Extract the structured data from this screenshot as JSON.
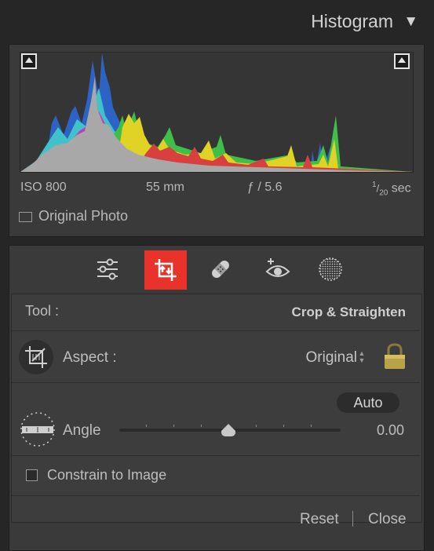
{
  "histogram": {
    "title": "Histogram",
    "toggle_glyph": "▼",
    "iso": "ISO 800",
    "focal_length": "55 mm",
    "aperture": "ƒ / 5.6",
    "shutter_num": "1",
    "shutter_den": "20",
    "shutter_unit": "sec",
    "original_photo_label": "Original Photo"
  },
  "toolstrip": {
    "icons": [
      "sliders-icon",
      "crop-icon",
      "healing-icon",
      "red-eye-icon",
      "masking-icon"
    ],
    "active": "crop-icon",
    "active_color": "#e8322a"
  },
  "crop": {
    "tool_label": "Tool :",
    "tool_value": "Crop & Straighten",
    "aspect_label": "Aspect :",
    "aspect_value": "Original",
    "auto_label": "Auto",
    "angle_label": "Angle",
    "angle_value": "0.00",
    "angle_slider_fraction": 0.5,
    "constrain_label": "Constrain to Image",
    "constrain_checked": false,
    "reset_label": "Reset",
    "close_label": "Close"
  }
}
